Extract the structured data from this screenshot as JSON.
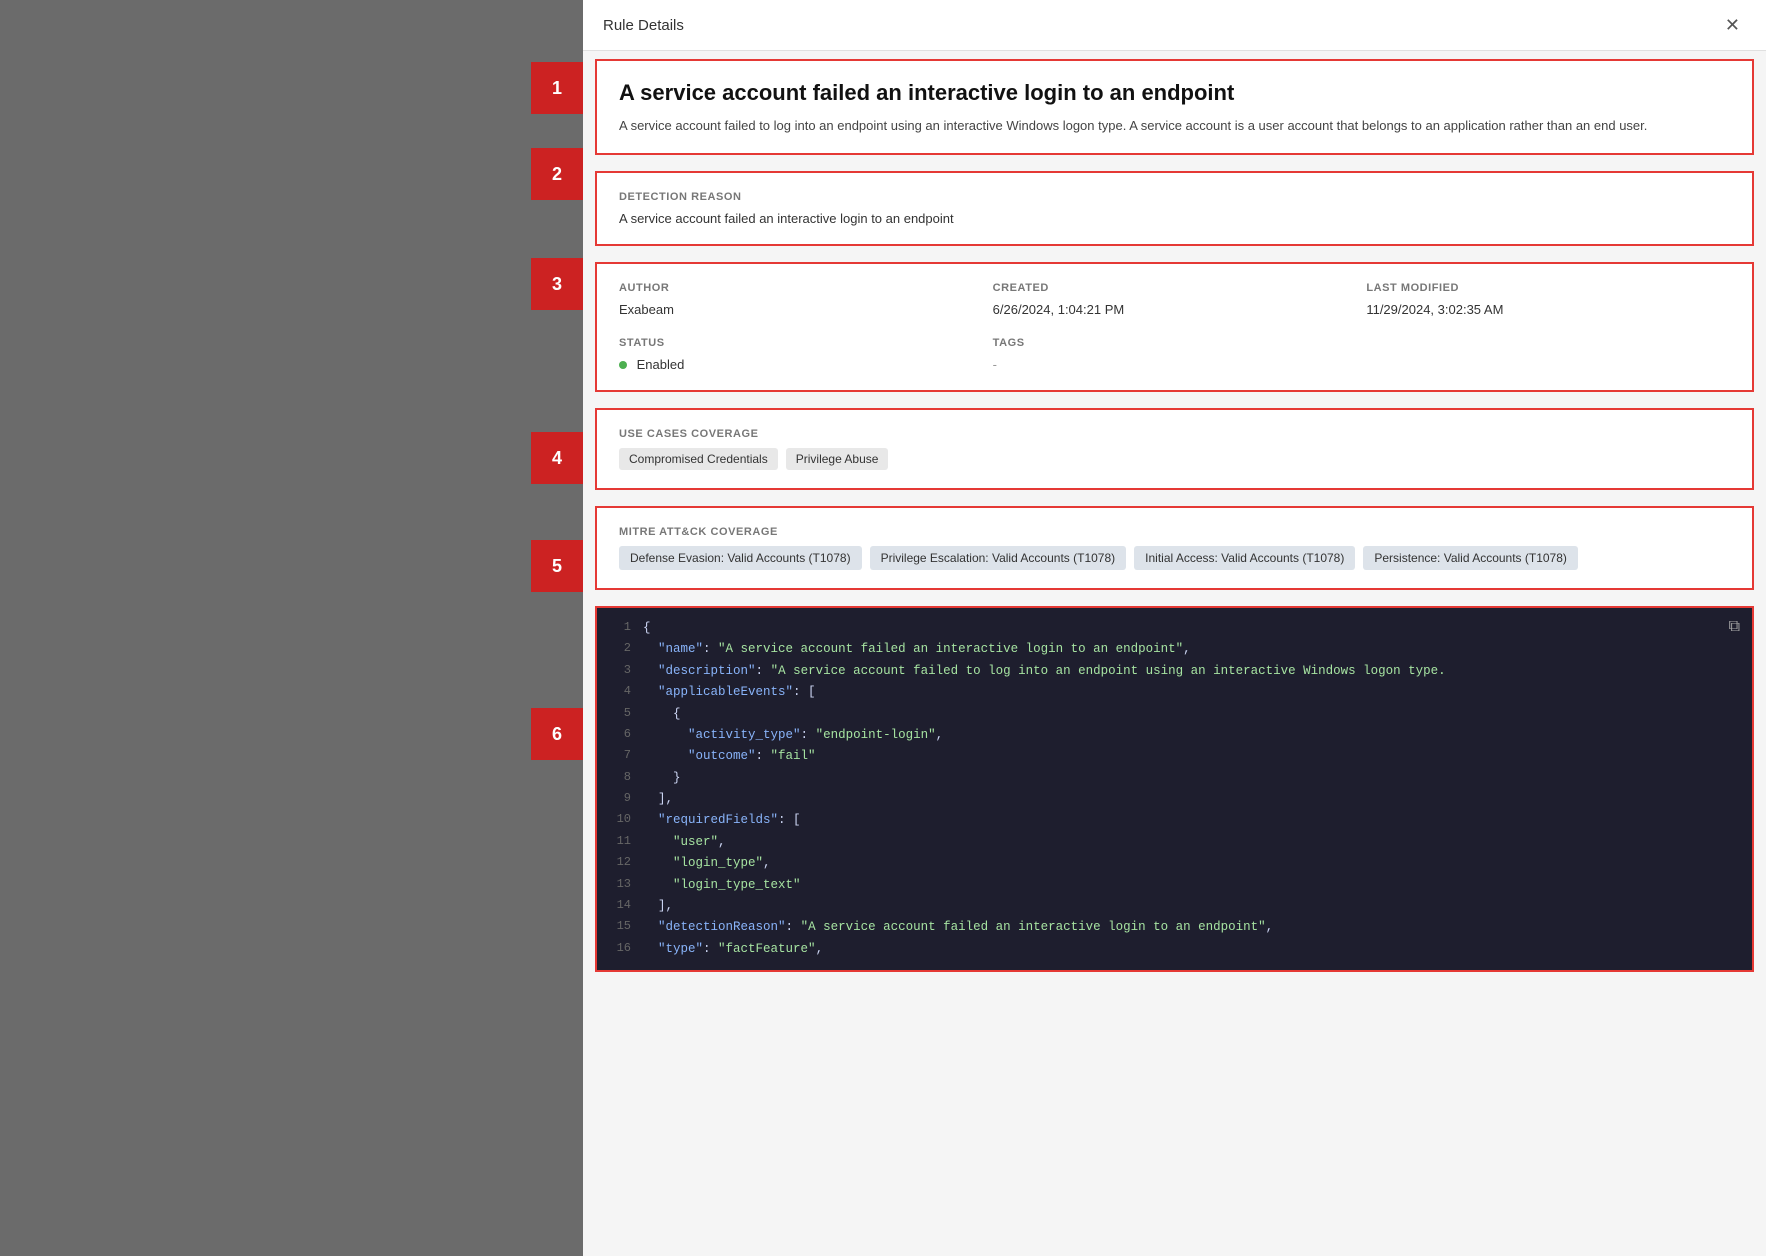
{
  "left": {
    "badges": [
      {
        "number": "1",
        "class": "badge-1"
      },
      {
        "number": "2",
        "class": "badge-2"
      },
      {
        "number": "3",
        "class": "badge-3"
      },
      {
        "number": "4",
        "class": "badge-4"
      },
      {
        "number": "5",
        "class": "badge-5"
      },
      {
        "number": "6",
        "class": "badge-6"
      }
    ]
  },
  "modal": {
    "header": {
      "title": "Rule Details",
      "close_icon": "✕"
    },
    "rule": {
      "title": "A service account failed an interactive login to an endpoint",
      "description": "A service account failed to log into an endpoint using an interactive Windows logon type. A service account is a user account that belongs to an application rather than an end user."
    },
    "detection_reason": {
      "label": "DETECTION REASON",
      "value": "A service account failed an interactive login to an endpoint"
    },
    "metadata": {
      "author_label": "AUTHOR",
      "author_value": "Exabeam",
      "created_label": "CREATED",
      "created_value": "6/26/2024, 1:04:21 PM",
      "last_modified_label": "LAST MODIFIED",
      "last_modified_value": "11/29/2024, 3:02:35 AM",
      "status_label": "STATUS",
      "status_value": "Enabled",
      "tags_label": "TAGS",
      "tags_value": "-"
    },
    "use_cases": {
      "label": "USE CASES COVERAGE",
      "tags": [
        "Compromised Credentials",
        "Privilege Abuse"
      ]
    },
    "mitre": {
      "label": "MITRE ATT&CK COVERAGE",
      "tags": [
        "Defense Evasion: Valid Accounts (T1078)",
        "Privilege Escalation: Valid Accounts (T1078)",
        "Initial Access: Valid Accounts (T1078)",
        "Persistence: Valid Accounts (T1078)"
      ]
    },
    "code": {
      "copy_icon": "⧉",
      "lines": [
        {
          "num": "1",
          "content": "{"
        },
        {
          "num": "2",
          "content": "  \"name\": \"A service account failed an interactive login to an endpoint\","
        },
        {
          "num": "3",
          "content": "  \"description\": \"A service account failed to log into an endpoint using an interactive Windows logon type."
        },
        {
          "num": "4",
          "content": "  \"applicableEvents\": ["
        },
        {
          "num": "5",
          "content": "    {"
        },
        {
          "num": "6",
          "content": "      \"activity_type\": \"endpoint-login\","
        },
        {
          "num": "7",
          "content": "      \"outcome\": \"fail\""
        },
        {
          "num": "8",
          "content": "    }"
        },
        {
          "num": "9",
          "content": "  ],"
        },
        {
          "num": "10",
          "content": "  \"requiredFields\": ["
        },
        {
          "num": "11",
          "content": "    \"user\","
        },
        {
          "num": "12",
          "content": "    \"login_type\","
        },
        {
          "num": "13",
          "content": "    \"login_type_text\""
        },
        {
          "num": "14",
          "content": "  ],"
        },
        {
          "num": "15",
          "content": "  \"detectionReason\": \"A service account failed an interactive login to an endpoint\","
        },
        {
          "num": "16",
          "content": "  \"type\": \"factFeature\","
        }
      ]
    }
  }
}
